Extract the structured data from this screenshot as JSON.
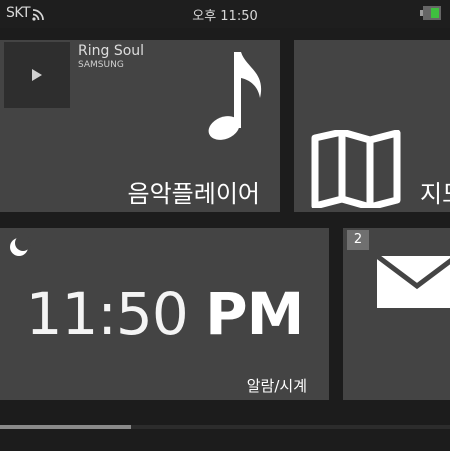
{
  "status_bar": {
    "carrier": "SKT",
    "time": "오후 11:50",
    "battery_color": "#3fbf3f"
  },
  "tiles": {
    "music": {
      "song_title": "Ring Soul",
      "artist": "SAMSUNG",
      "label": "음악플레이어",
      "icon": "music-note-icon"
    },
    "map": {
      "label": "지도",
      "icon": "map-icon"
    },
    "alarm": {
      "time_digits": "11:50",
      "time_period": "PM",
      "label": "알람/시계",
      "icon": "moon-icon"
    },
    "message": {
      "badge_count": "2",
      "icon": "envelope-icon"
    }
  },
  "scroll_indicator": {
    "position_fraction": 0.29
  },
  "colors": {
    "background": "#1c1c1c",
    "tile": "#444444",
    "text": "#ffffff"
  }
}
